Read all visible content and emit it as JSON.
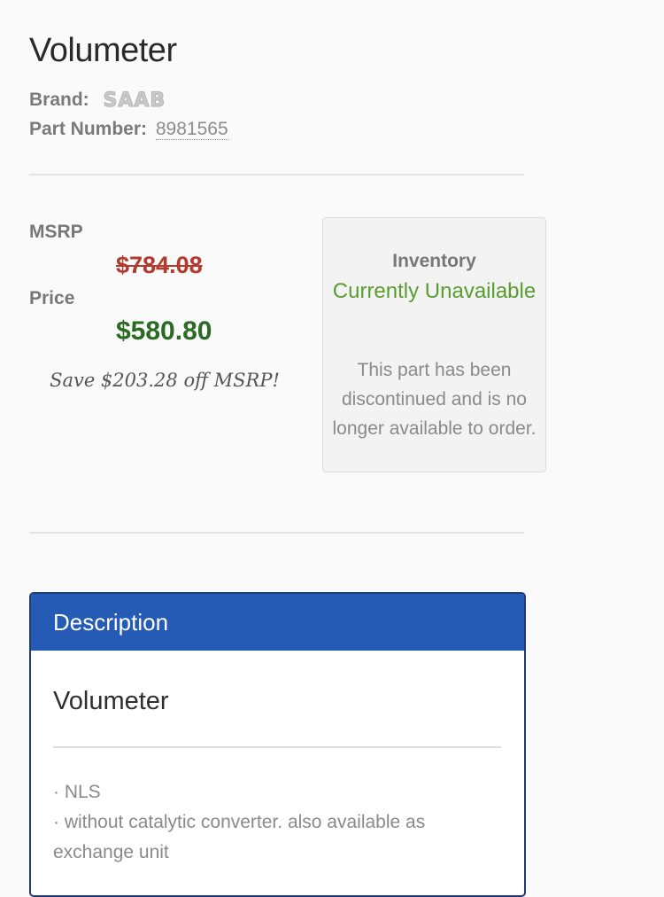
{
  "product": {
    "title": "Volumeter",
    "brand_label": "Brand:",
    "brand_logo_text": "SAAB",
    "part_number_label": "Part Number:",
    "part_number": "8981565"
  },
  "pricing": {
    "msrp_label": "MSRP",
    "msrp_value": "$784.08",
    "price_label": "Price",
    "price_value": "$580.80",
    "savings_text": "Save $203.28 off MSRP!",
    "colors": {
      "msrp": "#b23a2e",
      "price": "#2b6a23"
    }
  },
  "inventory": {
    "heading": "Inventory",
    "status": "Currently Unavailable",
    "status_color": "#5a9d2f",
    "note": "This part has been discontinued and is no longer available to order."
  },
  "description": {
    "header": "Description",
    "header_color": "#255bb4",
    "title": "Volumeter",
    "notes": [
      "· NLS",
      "· without catalytic converter. also available as exchange unit"
    ]
  }
}
